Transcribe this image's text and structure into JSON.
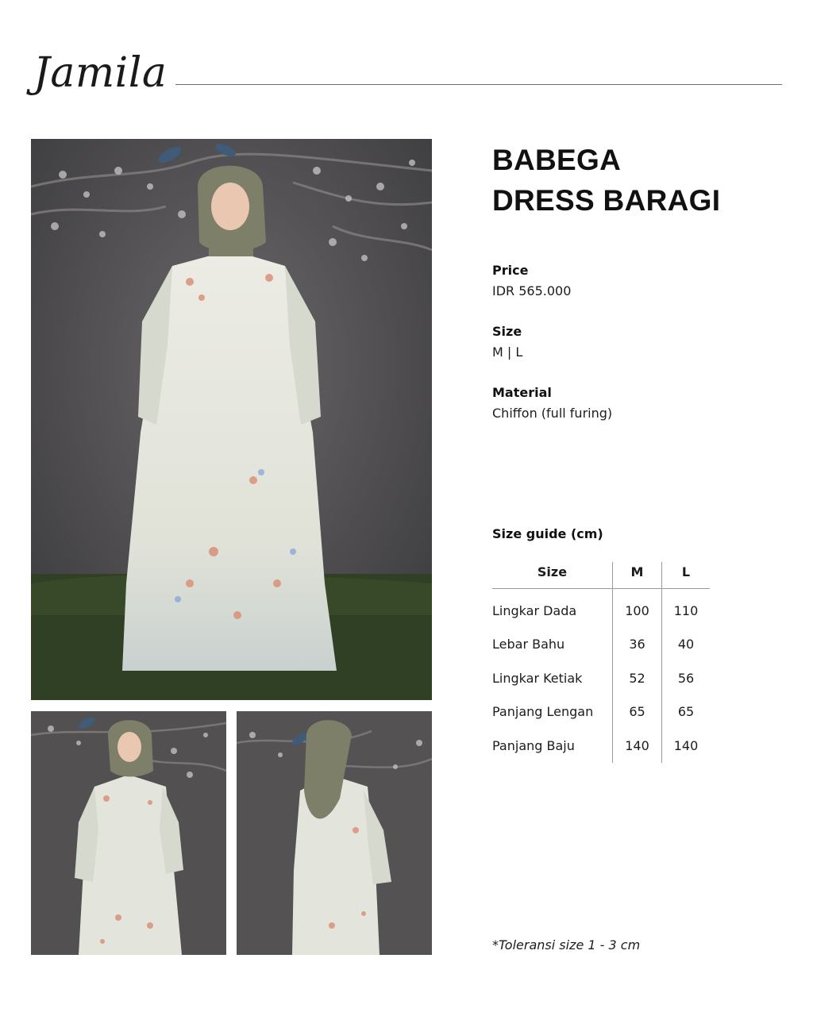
{
  "brand": {
    "name": "Jamila"
  },
  "product": {
    "title_line1": "BABEGA",
    "title_line2": "DRESS BARAGI"
  },
  "specs": {
    "price_label": "Price",
    "price_value": "IDR 565.000",
    "size_label": "Size",
    "size_value": "M | L",
    "material_label": "Material",
    "material_value": "Chiffon (full furing)"
  },
  "size_guide": {
    "title": "Size guide (cm)",
    "headers": [
      "Size",
      "M",
      "L"
    ],
    "rows": [
      {
        "label": "Lingkar Dada",
        "m": "100",
        "l": "110"
      },
      {
        "label": "Lebar Bahu",
        "m": "36",
        "l": "40"
      },
      {
        "label": "Lingkar Ketiak",
        "m": "52",
        "l": "56"
      },
      {
        "label": "Panjang Lengan",
        "m": "65",
        "l": "65"
      },
      {
        "label": "Panjang Baju",
        "m": "140",
        "l": "140"
      }
    ]
  },
  "tolerance_note": "*Toleransi size 1 - 3 cm",
  "colors": {
    "backdrop": "#4f4d4f",
    "moss": "#2f4024",
    "dress": "#e6e7df",
    "hijab": "#7d7f68"
  }
}
